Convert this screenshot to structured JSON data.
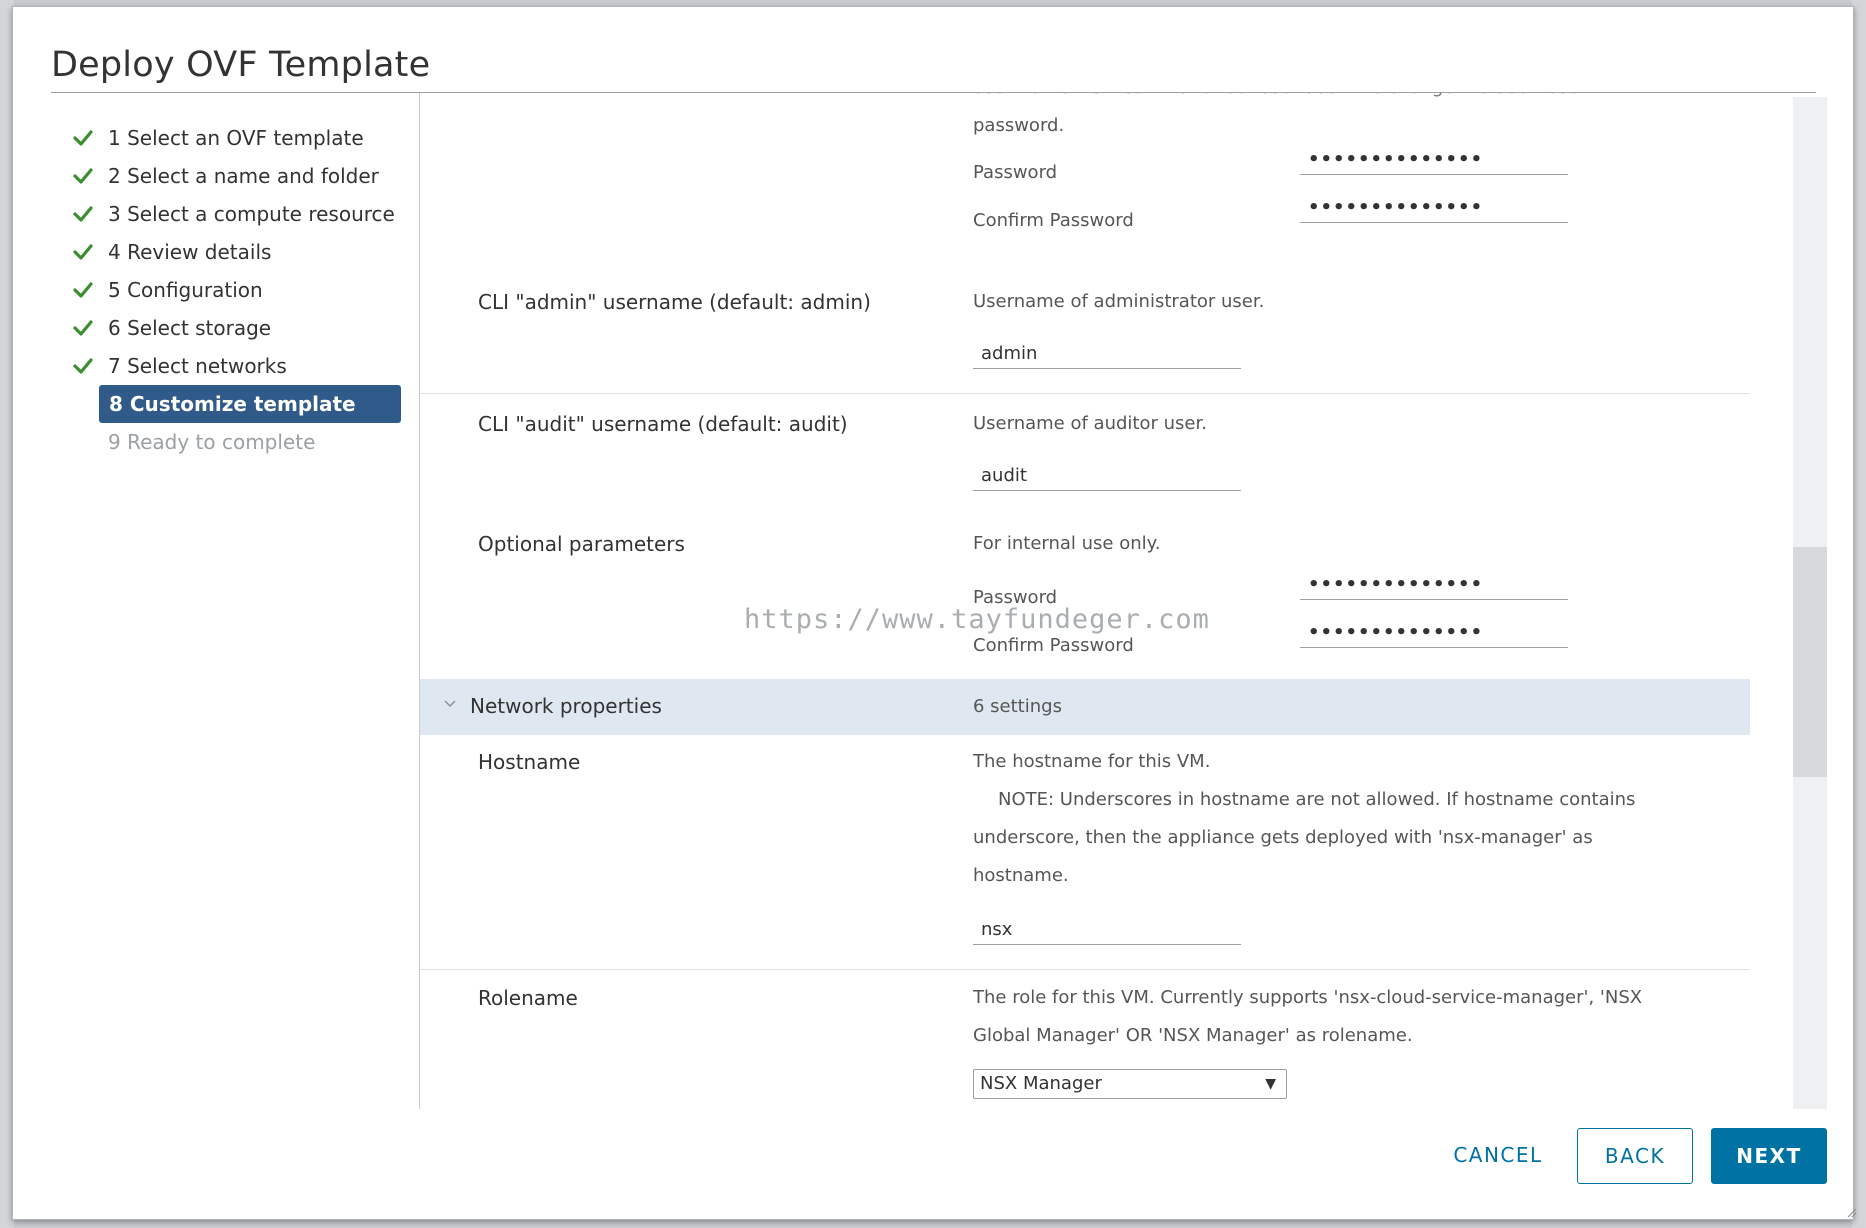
{
  "dialog": {
    "title": "Deploy OVF Template"
  },
  "steps": [
    {
      "label": "1 Select an OVF template",
      "state": "done"
    },
    {
      "label": "2 Select a name and folder",
      "state": "done"
    },
    {
      "label": "3 Select a compute resource",
      "state": "done"
    },
    {
      "label": "4 Review details",
      "state": "done"
    },
    {
      "label": "5 Configuration",
      "state": "done"
    },
    {
      "label": "6 Select storage",
      "state": "done"
    },
    {
      "label": "7 Select networks",
      "state": "done"
    },
    {
      "label": "8 Customize template",
      "state": "active"
    },
    {
      "label": "9 Ready to complete",
      "state": "disabled"
    }
  ],
  "content": {
    "audit_pw_block": {
      "desc_line1": "use the NSX CLI command \"set user audit\" to change the audit user",
      "desc_line2": "password.",
      "password_label": "Password",
      "password_value": "••••••••••••••",
      "confirm_label": "Confirm Password",
      "confirm_value": "••••••••••••••"
    },
    "cli_admin": {
      "label": "CLI \"admin\" username (default: admin)",
      "desc": "Username of administrator user.",
      "value": "admin"
    },
    "cli_audit": {
      "label": "CLI \"audit\" username (default: audit)",
      "desc": "Username of auditor user.",
      "value": "audit"
    },
    "optional": {
      "label": "Optional parameters",
      "desc": "For internal use only.",
      "password_label": "Password",
      "password_value": "••••••••••••••",
      "confirm_label": "Confirm Password",
      "confirm_value": "••••••••••••••"
    },
    "network_section": {
      "title": "Network properties",
      "count": "6 settings"
    },
    "hostname": {
      "label": "Hostname",
      "desc_line1": "The hostname for this VM.",
      "desc_line2": "NOTE: Underscores in hostname are not allowed.  If hostname contains",
      "desc_line3": "underscore, then the appliance gets deployed with 'nsx-manager' as",
      "desc_line4": "hostname.",
      "value": "nsx"
    },
    "rolename": {
      "label": "Rolename",
      "desc_line1": "The role for this VM. Currently supports 'nsx-cloud-service-manager', 'NSX",
      "desc_line2": "Global Manager' OR 'NSX Manager' as rolename.",
      "selected": "NSX Manager"
    }
  },
  "watermark": "https://www.tayfundeger.com",
  "footer": {
    "cancel": "CANCEL",
    "back": "BACK",
    "next": "NEXT"
  },
  "colors": {
    "accent": "#0072a3",
    "active_step": "#2f5a8a",
    "check": "#3c8d2f",
    "section_header": "#dfe8f1"
  }
}
